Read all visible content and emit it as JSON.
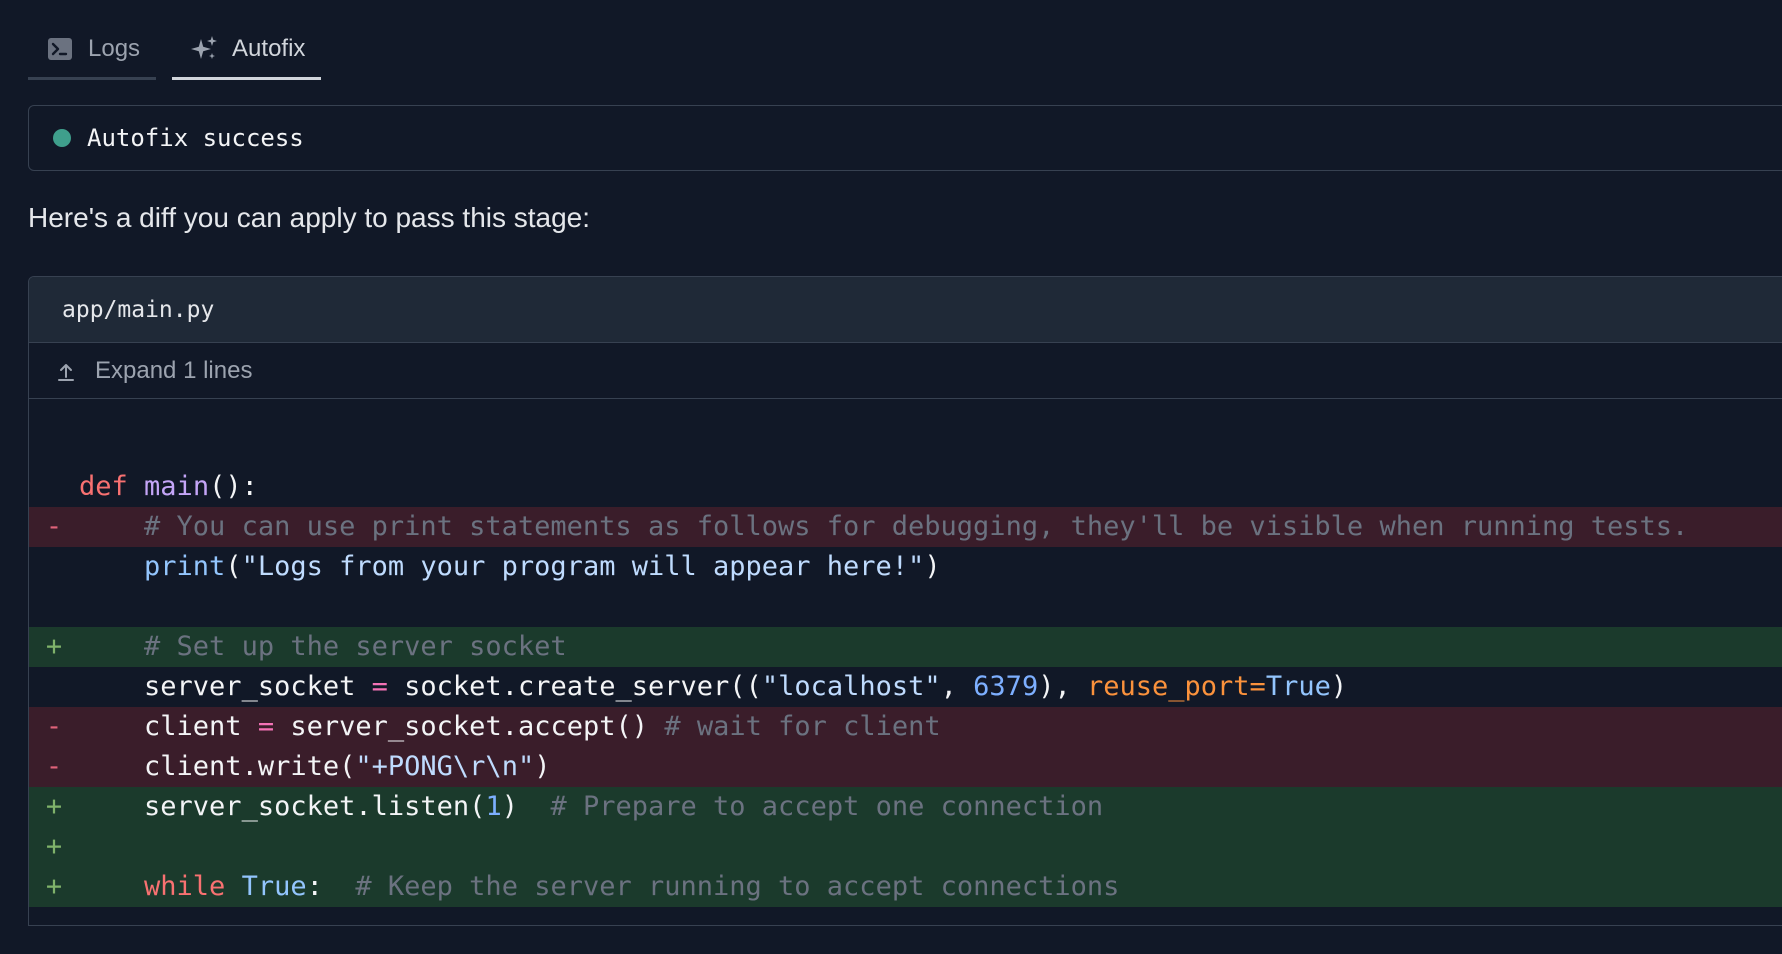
{
  "tabs": [
    {
      "label": "Logs",
      "icon": "terminal-icon",
      "active": false
    },
    {
      "label": "Autofix",
      "icon": "sparkles-icon",
      "active": true
    }
  ],
  "status": {
    "text": "Autofix success",
    "color": "#3f9f8c"
  },
  "intro": "Here's a diff you can apply to pass this stage:",
  "diff": {
    "file": "app/main.py",
    "expand_label": "Expand 1 lines",
    "expand_icon": "arrow-up-to-line-icon",
    "lines": [
      {
        "type": "ctx",
        "marker": " ",
        "text": "def main():"
      },
      {
        "type": "del",
        "marker": "-",
        "text": "    # You can use print statements as follows for debugging, they'll be visible when running tests."
      },
      {
        "type": "ctx",
        "marker": " ",
        "text": "    print(\"Logs from your program will appear here!\")"
      },
      {
        "type": "ctx",
        "marker": " ",
        "text": ""
      },
      {
        "type": "add",
        "marker": "+",
        "text": "    # Set up the server socket"
      },
      {
        "type": "ctx",
        "marker": " ",
        "text": "    server_socket = socket.create_server((\"localhost\", 6379), reuse_port=True)"
      },
      {
        "type": "del",
        "marker": "-",
        "text": "    client = server_socket.accept() # wait for client"
      },
      {
        "type": "del",
        "marker": "-",
        "text": "    client.write(\"+PONG\\r\\n\")"
      },
      {
        "type": "add",
        "marker": "+",
        "text": "    server_socket.listen(1)  # Prepare to accept one connection"
      },
      {
        "type": "add",
        "marker": "+",
        "text": ""
      },
      {
        "type": "add",
        "marker": "+",
        "text": "    while True:  # Keep the server running to accept connections"
      }
    ]
  },
  "colors": {
    "background": "#111827",
    "deleted_line": "#3a1d2a",
    "added_line": "#1b3a2c",
    "success_dot": "#3f9f8c"
  }
}
